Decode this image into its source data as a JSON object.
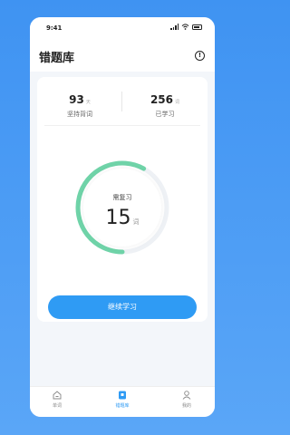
{
  "status_bar": {
    "time": "9:41"
  },
  "header": {
    "title": "错题库",
    "info_glyph": "!"
  },
  "stats": {
    "persist": {
      "value": "93",
      "unit": "天",
      "label": "坚持背词"
    },
    "learned": {
      "value": "256",
      "unit": "词",
      "label": "已学习"
    }
  },
  "review": {
    "label": "需复习",
    "count": "15",
    "unit": "词",
    "progress": 0.58
  },
  "action": {
    "continue_label": "继续学习"
  },
  "tabs": [
    {
      "label": "单词",
      "icon": "home-icon",
      "active": false
    },
    {
      "label": "错题库",
      "icon": "book-icon",
      "active": true
    },
    {
      "label": "我的",
      "icon": "user-icon",
      "active": false
    }
  ],
  "colors": {
    "accent": "#2f9bf4",
    "progress": "#6fd3a8",
    "background": "#4a9cf4"
  }
}
